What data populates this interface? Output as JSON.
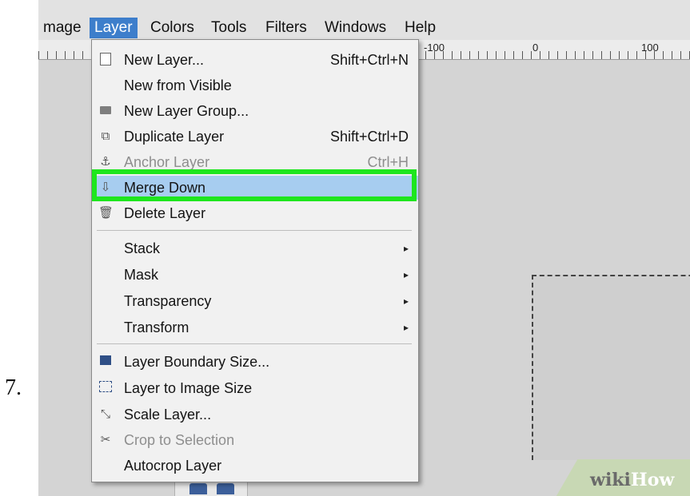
{
  "step": {
    "number": "7."
  },
  "menubar": {
    "items": [
      {
        "label": "mage"
      },
      {
        "label": "Layer"
      },
      {
        "label": "Colors"
      },
      {
        "label": "Tools"
      },
      {
        "label": "Filters"
      },
      {
        "label": "Windows"
      },
      {
        "label": "Help"
      }
    ]
  },
  "ruler": {
    "labels": [
      "-100",
      "0",
      "100"
    ]
  },
  "layer_menu": {
    "items": [
      {
        "label": "New Layer...",
        "shortcut": "Shift+Ctrl+N",
        "icon": "new-layer-icon"
      },
      {
        "label": "New from Visible",
        "shortcut": "",
        "icon": ""
      },
      {
        "label": "New Layer Group...",
        "shortcut": "",
        "icon": "folder-icon"
      },
      {
        "label": "Duplicate Layer",
        "shortcut": "Shift+Ctrl+D",
        "icon": "duplicate-icon"
      },
      {
        "label": "Anchor Layer",
        "shortcut": "Ctrl+H",
        "icon": "anchor-icon",
        "disabled": true
      },
      {
        "label": "Merge Down",
        "shortcut": "",
        "icon": "merge-down-icon",
        "highlighted": true
      },
      {
        "label": "Delete Layer",
        "shortcut": "",
        "icon": "delete-icon"
      },
      {
        "label": "Stack",
        "submenu": true
      },
      {
        "label": "Mask",
        "submenu": true
      },
      {
        "label": "Transparency",
        "submenu": true
      },
      {
        "label": "Transform",
        "submenu": true
      },
      {
        "label": "Layer Boundary Size...",
        "icon": "boundary-size-icon"
      },
      {
        "label": "Layer to Image Size",
        "icon": "layer-to-image-icon"
      },
      {
        "label": "Scale Layer...",
        "icon": "scale-icon"
      },
      {
        "label": "Crop to Selection",
        "icon": "crop-icon",
        "disabled": true
      },
      {
        "label": "Autocrop Layer",
        "icon": ""
      }
    ],
    "submenu_arrow": "▸"
  },
  "watermark": {
    "part1": "wiki",
    "part2": "How"
  },
  "colors": {
    "highlight_border": "#1ee61e",
    "menu_active": "#3d7ecb",
    "item_highlight": "#a7cdf0"
  }
}
